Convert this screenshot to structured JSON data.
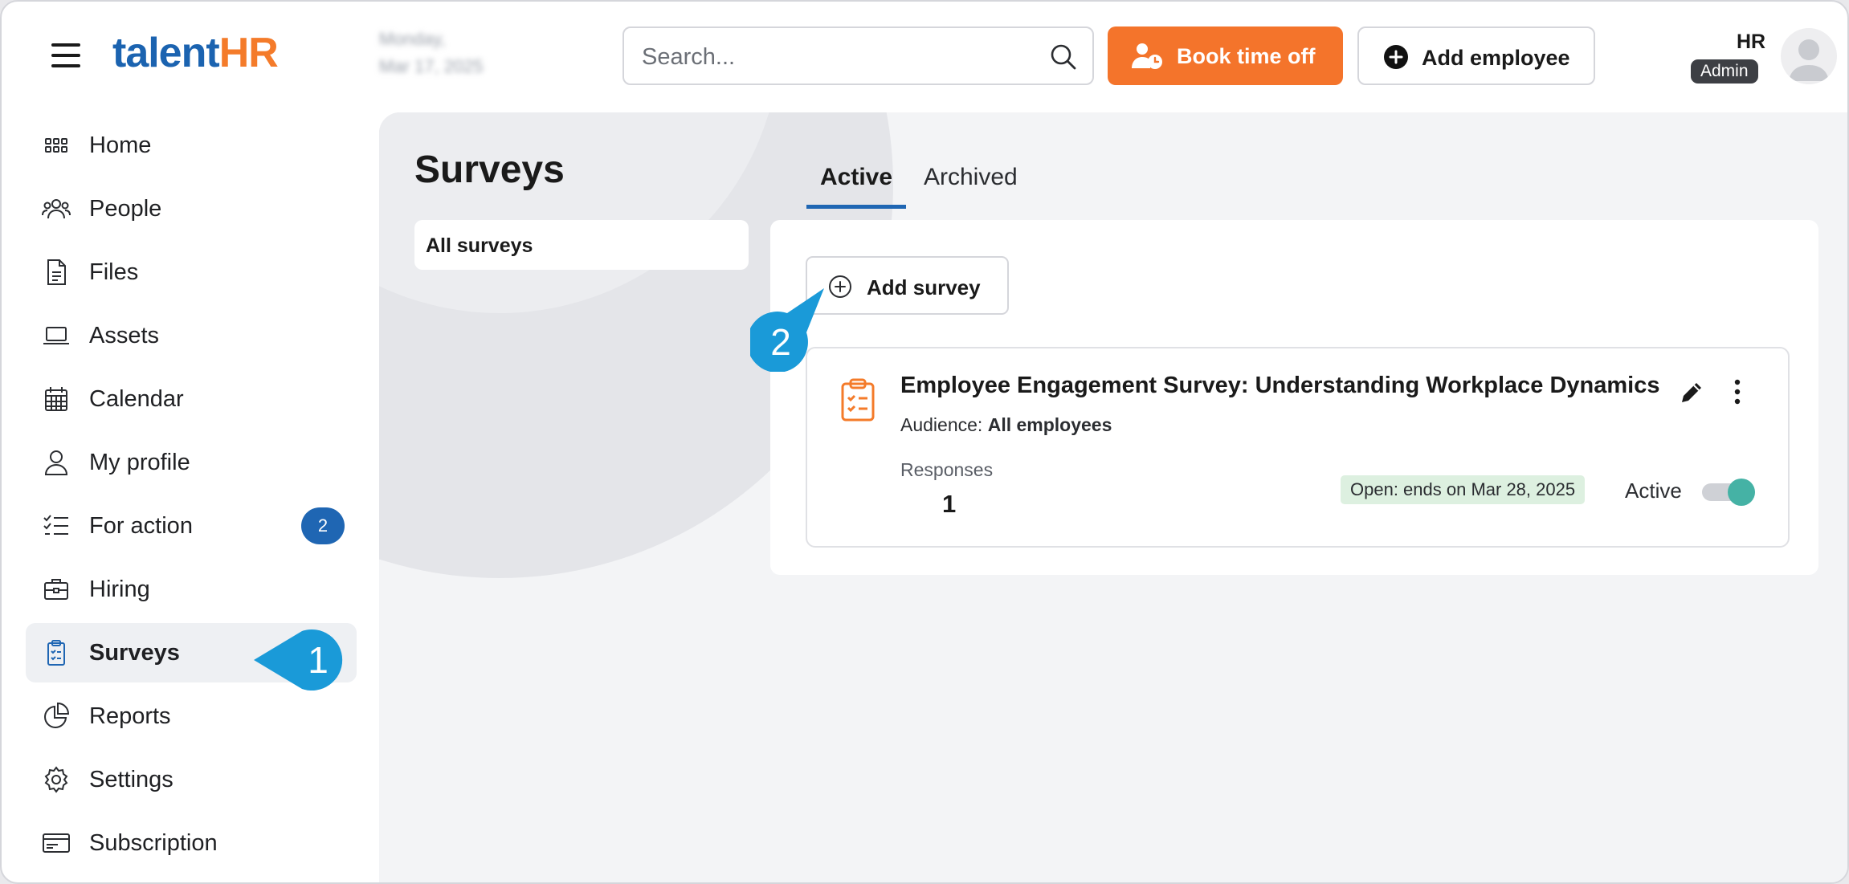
{
  "header": {
    "logo_main": "talent",
    "logo_accent": "HR",
    "date_line1": "Monday,",
    "date_line2": "Mar 17, 2025",
    "search_placeholder": "Search...",
    "book_time_off_label": "Book time off",
    "add_employee_label": "Add employee",
    "user_name": "HR",
    "user_role": "Admin"
  },
  "sidebar": {
    "items": [
      {
        "label": "Home",
        "icon": "grid-icon"
      },
      {
        "label": "People",
        "icon": "people-icon"
      },
      {
        "label": "Files",
        "icon": "file-icon"
      },
      {
        "label": "Assets",
        "icon": "laptop-icon"
      },
      {
        "label": "Calendar",
        "icon": "calendar-icon"
      },
      {
        "label": "My profile",
        "icon": "person-icon"
      },
      {
        "label": "For action",
        "icon": "checklist-icon",
        "badge": "2"
      },
      {
        "label": "Hiring",
        "icon": "briefcase-icon"
      },
      {
        "label": "Surveys",
        "icon": "clipboard-icon",
        "active": true
      },
      {
        "label": "Reports",
        "icon": "pie-chart-icon"
      },
      {
        "label": "Settings",
        "icon": "gear-icon"
      },
      {
        "label": "Subscription",
        "icon": "card-icon"
      }
    ]
  },
  "main": {
    "title": "Surveys",
    "filter_label": "All surveys",
    "tabs": [
      {
        "label": "Active",
        "active": true
      },
      {
        "label": "Archived",
        "active": false
      }
    ],
    "add_survey_label": "Add survey",
    "survey": {
      "title": "Employee Engagement Survey: Understanding Workplace Dynamics",
      "audience_label": "Audience:",
      "audience_value": "All employees",
      "responses_label": "Responses",
      "responses_value": "1",
      "status": "Open: ends on Mar 28, 2025",
      "active_label": "Active",
      "active_on": true
    }
  },
  "callouts": {
    "step1": "1",
    "step2": "2"
  },
  "colors": {
    "brand_blue": "#1b63b0",
    "brand_orange": "#f47b2a",
    "callout_blue": "#1a9ad8",
    "toggle_on": "#45b2a5",
    "status_bg": "#ddf0e0"
  }
}
